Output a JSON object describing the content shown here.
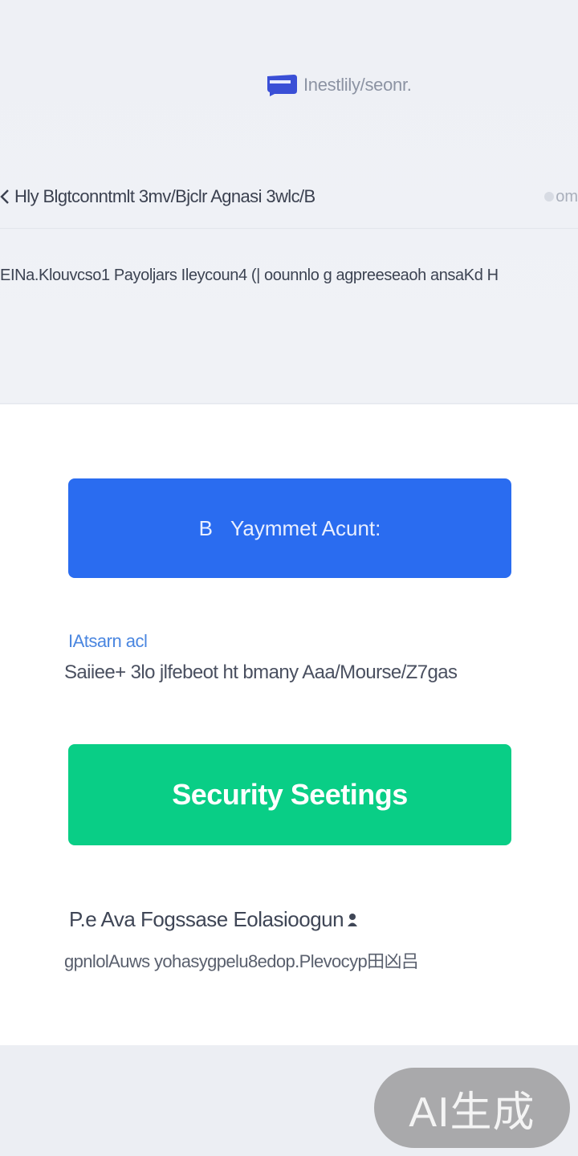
{
  "brand": {
    "logo_icon": "card-logo-icon",
    "title": "Inestlily/seonr."
  },
  "header": {
    "back_icon": "chevron-left-icon",
    "title": "Hly Blgtconntmlt 3mv/Bjclr Agnasi 3wlc/B",
    "right_text": "om"
  },
  "subheader": {
    "text": "EINa.Klouvcso1 Payoljars Ileycoun4 (| oounnlo g agpreeseaoh ansaKd H"
  },
  "buttons": {
    "payment_prefix": "B",
    "payment_label": "Yaymmet Acunt:",
    "security_label": "Security Seetings"
  },
  "payment_section": {
    "link_label": "IAtsarn acl",
    "description": "Saiiee+ 3lo jlfebeot ht bmany Aaa/Mourse/Z7gas"
  },
  "security_section": {
    "title": "P.e Ava Fogssase Eolasioogun",
    "description": "gpnlolAuws yohasygpelu8edop.Plevocyp田凶吕"
  },
  "watermark": {
    "text": "AI生成"
  },
  "colors": {
    "primary": "#2a6cf0",
    "success": "#09ce86",
    "link": "#4a86e0",
    "brand_logo": "#3a4fd6"
  }
}
